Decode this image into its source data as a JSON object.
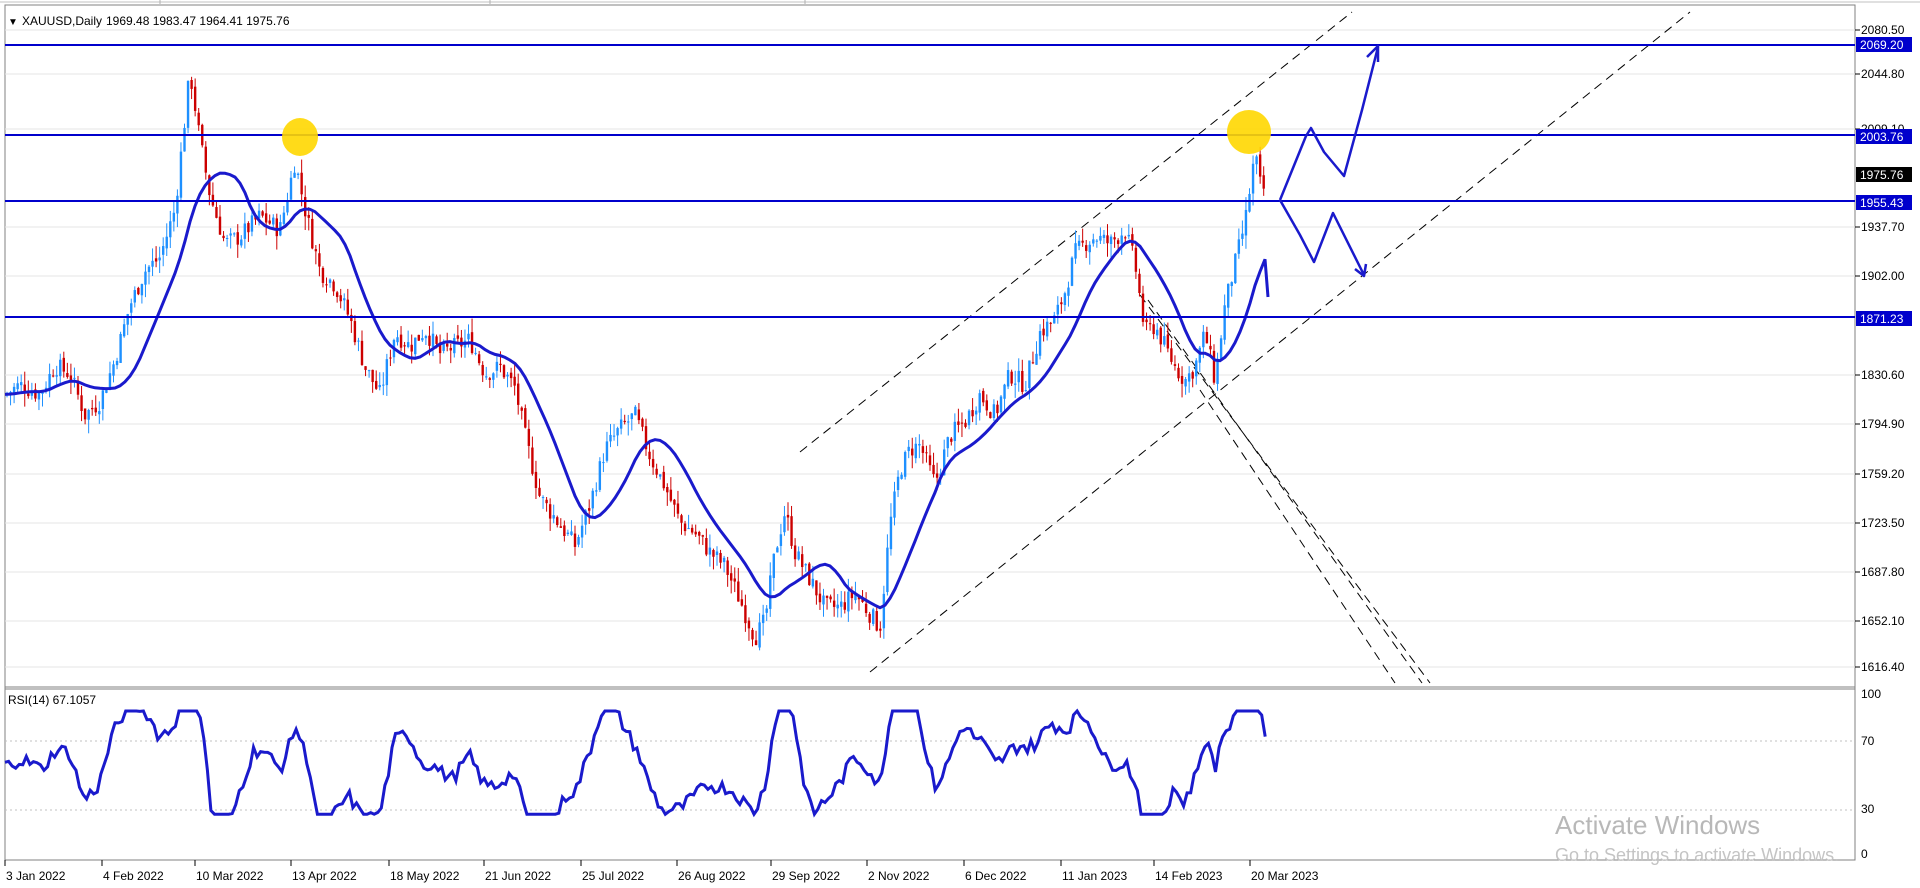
{
  "header": {
    "symbol_line": "XAUUSD,Daily",
    "ohlc": "1969.48 1983.47 1964.41 1975.76",
    "menu_glyph": "▼"
  },
  "rsi": {
    "label": "RSI(14) 67.1057",
    "ticks": [
      "100",
      "70",
      "30",
      "0"
    ],
    "color": "#1a1acc"
  },
  "price_axis": {
    "ticks": [
      "2080.50",
      "2044.80",
      "2009.10",
      "1937.70",
      "1902.00",
      "1830.60",
      "1794.90",
      "1759.20",
      "1723.50",
      "1687.80",
      "1652.10",
      "1616.40"
    ]
  },
  "level_labels": {
    "r2069": "2069.20",
    "r2003": "2003.76",
    "bid": "1975.76",
    "r1955": "1955.43",
    "r1871": "1871.23"
  },
  "x_axis": {
    "labels": [
      "3 Jan 2022",
      "4 Feb 2022",
      "10 Mar 2022",
      "13 Apr 2022",
      "18 May 2022",
      "21 Jun 2022",
      "25 Jul 2022",
      "26 Aug 2022",
      "29 Sep 2022",
      "2 Nov 2022",
      "6 Dec 2022",
      "11 Jan 2023",
      "14 Feb 2023",
      "20 Mar 2023"
    ]
  },
  "watermark": {
    "line1": "Activate Windows",
    "line2": "Go to Settings to activate Windows."
  },
  "colors": {
    "bull": "#1e90ff",
    "bear": "#cc0000",
    "ma": "#1a1acc",
    "level": "#0000cc",
    "highlight": "#ffd700",
    "bid_bg": "#000000"
  },
  "chart_data": {
    "type": "candlestick",
    "symbol": "XAUUSD",
    "timeframe": "Daily",
    "last_bar": {
      "open": 1969.48,
      "high": 1983.47,
      "low": 1964.41,
      "close": 1975.76
    },
    "horizontal_levels": [
      2069.2,
      2003.76,
      1955.43,
      1871.23
    ],
    "ylim": [
      1600,
      2095
    ],
    "rsi_value": 67.1057,
    "rsi_levels": [
      30,
      70
    ],
    "rsi_range": [
      0,
      100
    ]
  }
}
